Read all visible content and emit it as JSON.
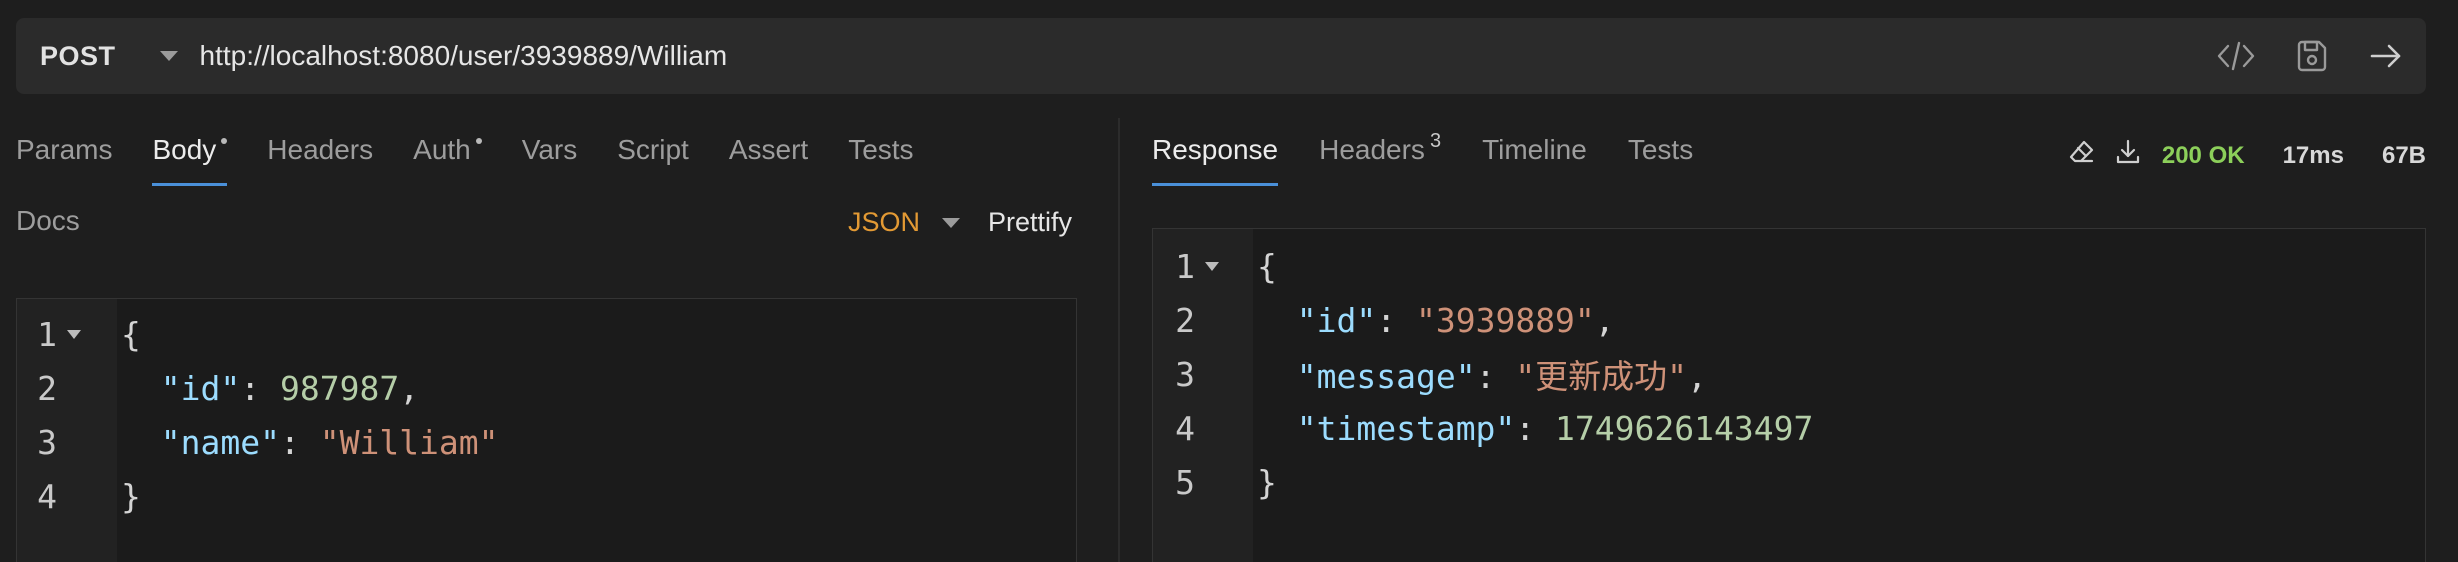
{
  "request": {
    "method": "POST",
    "url": "http://localhost:8080/user/3939889/William"
  },
  "icons": {
    "code": "code-icon",
    "save": "save-icon",
    "send": "arrow-right-icon",
    "clear": "eraser-icon",
    "download": "download-icon",
    "method_dropdown": "chevron-down-icon"
  },
  "request_tabs": [
    {
      "label": "Params"
    },
    {
      "label": "Body",
      "active": true,
      "dot": true
    },
    {
      "label": "Headers"
    },
    {
      "label": "Auth",
      "dot": true
    },
    {
      "label": "Vars"
    },
    {
      "label": "Script"
    },
    {
      "label": "Assert"
    },
    {
      "label": "Tests"
    }
  ],
  "docs_label": "Docs",
  "body_mode": "JSON",
  "prettify_label": "Prettify",
  "request_body": {
    "lines": [
      "1",
      "2",
      "3",
      "4"
    ],
    "line2_key": "\"id\"",
    "line2_value": "987987",
    "line3_key": "\"name\"",
    "line3_value": "\"William\""
  },
  "response_tabs": [
    {
      "label": "Response",
      "active": true
    },
    {
      "label": "Headers",
      "count": "3"
    },
    {
      "label": "Timeline"
    },
    {
      "label": "Tests"
    }
  ],
  "response_status": {
    "status": "200 OK",
    "time": "17ms",
    "size": "67B"
  },
  "response_body": {
    "lines": [
      "1",
      "2",
      "3",
      "4",
      "5"
    ],
    "line2_key": "\"id\"",
    "line2_value": "\"3939889\"",
    "line3_key": "\"message\"",
    "line3_value": "\"更新成功\"",
    "line4_key": "\"timestamp\"",
    "line4_value": "1749626143497"
  },
  "colors": {
    "accent_tab": "#4a90d9",
    "status_ok": "#8ccf5a",
    "json_mode": "#e39a34",
    "json_key": "#9cdcfe",
    "json_string": "#ce9178",
    "json_number": "#b5cea8"
  }
}
